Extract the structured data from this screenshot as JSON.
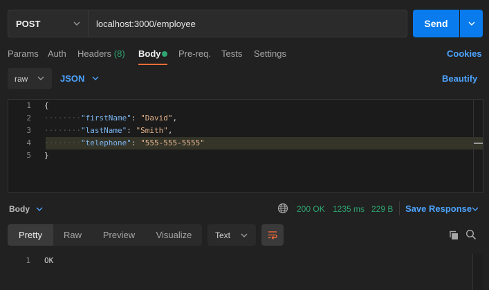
{
  "request": {
    "method": "POST",
    "url": "localhost:3000/employee",
    "send_label": "Send"
  },
  "tabs": [
    {
      "label": "Params"
    },
    {
      "label": "Auth"
    },
    {
      "label": "Headers",
      "count": "(8)"
    },
    {
      "label": "Body"
    },
    {
      "label": "Pre-req."
    },
    {
      "label": "Tests"
    },
    {
      "label": "Settings"
    }
  ],
  "cookies_label": "Cookies",
  "body_mode": {
    "mode": "raw",
    "format": "JSON",
    "beautify_label": "Beautify"
  },
  "editor": {
    "line_numbers": [
      "1",
      "2",
      "3",
      "4",
      "5"
    ],
    "json": {
      "open": "{",
      "close": "}",
      "fields": [
        {
          "key": "\"firstName\"",
          "value": "\"David\"",
          "sep": ","
        },
        {
          "key": "\"lastName\"",
          "value": "\"Smith\"",
          "sep": ","
        },
        {
          "key": "\"telephone\"",
          "value": "\"555-555-5555\"",
          "sep": ""
        }
      ]
    }
  },
  "response": {
    "body_label": "Body",
    "status": "200 OK",
    "time": "1235 ms",
    "size": "229 B",
    "save_label": "Save Response",
    "views": [
      "Pretty",
      "Raw",
      "Preview",
      "Visualize"
    ],
    "text_format": "Text",
    "line_number": "1",
    "body": "OK"
  },
  "colors": {
    "accent": "#097bed",
    "link": "#4da3ff",
    "success": "#2ea672",
    "active_tab": "#ff6c37"
  }
}
